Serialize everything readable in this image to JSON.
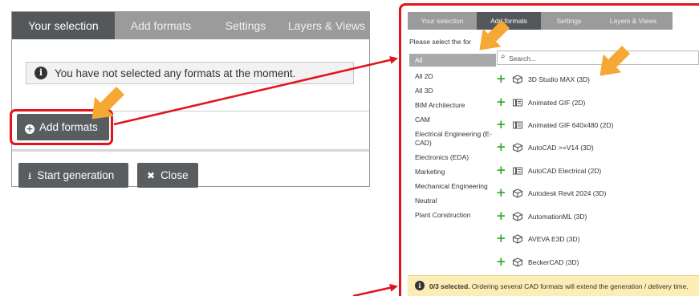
{
  "left": {
    "tabs": [
      {
        "label": "Your selection",
        "active": true
      },
      {
        "label": "Add formats",
        "active": false
      },
      {
        "label": "Settings",
        "active": false
      },
      {
        "label": "Layers & Views",
        "active": false
      }
    ],
    "info_message": "You have not selected any formats at the moment.",
    "add_formats_button": "Add formats",
    "start_generation_button": "Start generation",
    "close_button": "Close"
  },
  "right": {
    "tabs": [
      {
        "label": "Your selection",
        "active": false
      },
      {
        "label": "Add formats",
        "active": true
      },
      {
        "label": "Settings",
        "active": false
      },
      {
        "label": "Layers & Views",
        "active": false
      }
    ],
    "prompt": "Please select the for",
    "search_placeholder": "Search...",
    "categories": [
      {
        "label": "All",
        "selected": true
      },
      {
        "label": "All 2D",
        "selected": false
      },
      {
        "label": "All 3D",
        "selected": false
      },
      {
        "label": "BIM Architecture",
        "selected": false
      },
      {
        "label": "CAM",
        "selected": false
      },
      {
        "label": "Electrical Engineering (E-",
        "selected": false
      },
      {
        "label": "CAD)",
        "selected": false
      },
      {
        "label": "Electronics (EDA)",
        "selected": false
      },
      {
        "label": "Marketing",
        "selected": false
      },
      {
        "label": "Mechanical Engineering",
        "selected": false
      },
      {
        "label": "Neutral",
        "selected": false
      },
      {
        "label": "Plant Construction",
        "selected": false
      }
    ],
    "formats": [
      {
        "label": "3D Studio MAX (3D)",
        "icon": "cube-icon"
      },
      {
        "label": "Animated GIF (2D)",
        "icon": "drawing-icon"
      },
      {
        "label": "Animated GIF 640x480 (2D)",
        "icon": "drawing-icon"
      },
      {
        "label": "AutoCAD >=V14 (3D)",
        "icon": "cube-icon"
      },
      {
        "label": "AutoCAD Electrical (2D)",
        "icon": "drawing-icon"
      },
      {
        "label": "Autodesk Revit 2024 (3D)",
        "icon": "cube-icon"
      },
      {
        "label": "AutomationML (3D)",
        "icon": "cube-icon"
      },
      {
        "label": "AVEVA E3D (3D)",
        "icon": "cube-icon"
      },
      {
        "label": "BeckerCAD (3D)",
        "icon": "cube-icon"
      }
    ],
    "footer": {
      "count": "0/3 selected.",
      "message": " Ordering several CAD formats will extend the generation / delivery time."
    }
  },
  "colors": {
    "highlight_red": "#e1141c",
    "arrow_orange": "#f5a833",
    "tab_bar_gray": "#9b9b9b",
    "tab_active_dark": "#55585b",
    "button_dark": "#5a5d60",
    "add_green": "#39a935",
    "footer_yellow": "#fbedb4"
  }
}
